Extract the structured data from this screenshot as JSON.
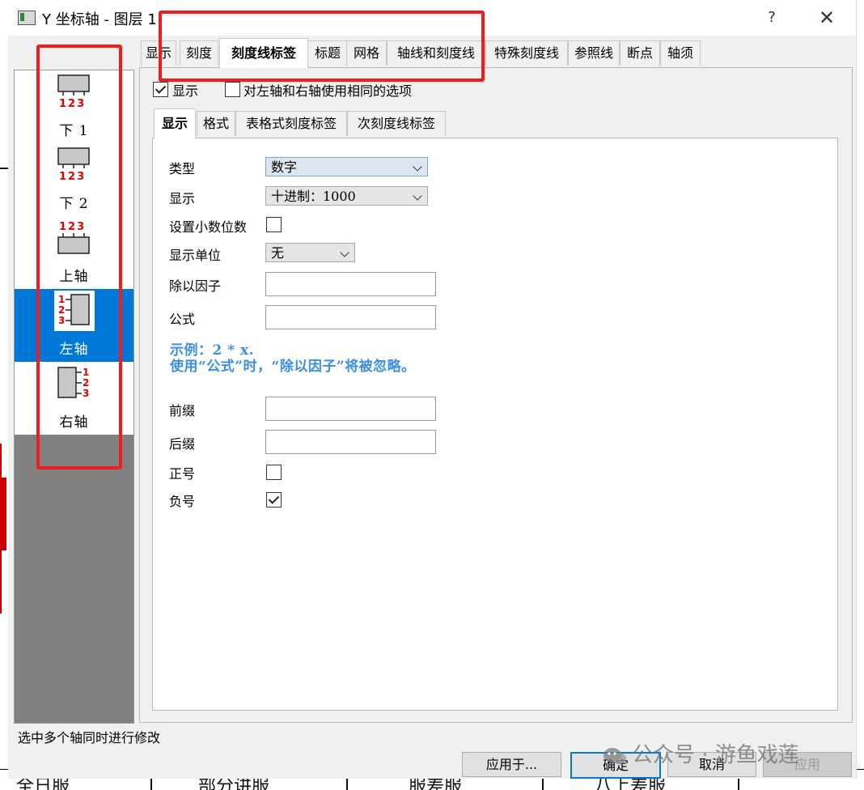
{
  "window": {
    "title": "Y 坐标轴 - 图层 1",
    "help_label": "?",
    "close_label": "✕"
  },
  "axis_list": {
    "items": [
      {
        "label": "下 1",
        "icon": "bottom-axis-icon",
        "ticks": "123",
        "selected": false
      },
      {
        "label": "下 2",
        "icon": "bottom-axis-icon",
        "ticks": "123",
        "selected": false
      },
      {
        "label": "上轴",
        "icon": "top-axis-icon",
        "ticks": "123",
        "selected": false
      },
      {
        "label": "左轴",
        "icon": "left-axis-icon",
        "ticks": "123",
        "selected": true
      },
      {
        "label": "右轴",
        "icon": "right-axis-icon",
        "ticks": "123",
        "selected": false
      }
    ]
  },
  "tabs": {
    "items": [
      "显示",
      "刻度",
      "刻度线标签",
      "标题",
      "网格",
      "轴线和刻度线",
      "特殊刻度线",
      "参照线",
      "断点",
      "轴须"
    ],
    "active": "刻度线标签"
  },
  "options": {
    "show_label": "显示",
    "show_checked": true,
    "same_options_label": "对左轴和右轴使用相同的选项",
    "same_options_checked": false
  },
  "sub_tabs": {
    "items": [
      "显示",
      "格式",
      "表格式刻度标签",
      "次刻度线标签"
    ],
    "active": "显示"
  },
  "form": {
    "type_label": "类型",
    "type_value": "数字",
    "display_label": "显示",
    "display_value": "十进制：1000",
    "decimal_label": "设置小数位数",
    "decimal_checked": false,
    "unit_label": "显示单位",
    "unit_value": "无",
    "divide_label": "除以因子",
    "divide_value": "",
    "formula_label": "公式",
    "formula_value": "",
    "example_line1": "示例：2 * x.",
    "example_line2": "使用“公式”时，“除以因子”将被忽略。",
    "prefix_label": "前缀",
    "prefix_value": "",
    "suffix_label": "后缀",
    "suffix_value": "",
    "plus_label": "正号",
    "plus_checked": false,
    "minus_label": "负号",
    "minus_checked": true
  },
  "status": {
    "text": "选中多个轴同时进行修改"
  },
  "buttons": {
    "apply_to": "应用于...",
    "ok": "确定",
    "cancel": "取消",
    "apply": "应用"
  },
  "watermark": {
    "text": "公众号 · 游鱼戏莲"
  },
  "background": {
    "cells": [
      "全日服",
      "部分讲服",
      "服差服",
      "八上差服"
    ]
  },
  "colors": {
    "accent": "#0078d7",
    "highlight": "#ef1d1d",
    "example_text": "#3a8ee6",
    "tick_label": "#e00000"
  }
}
